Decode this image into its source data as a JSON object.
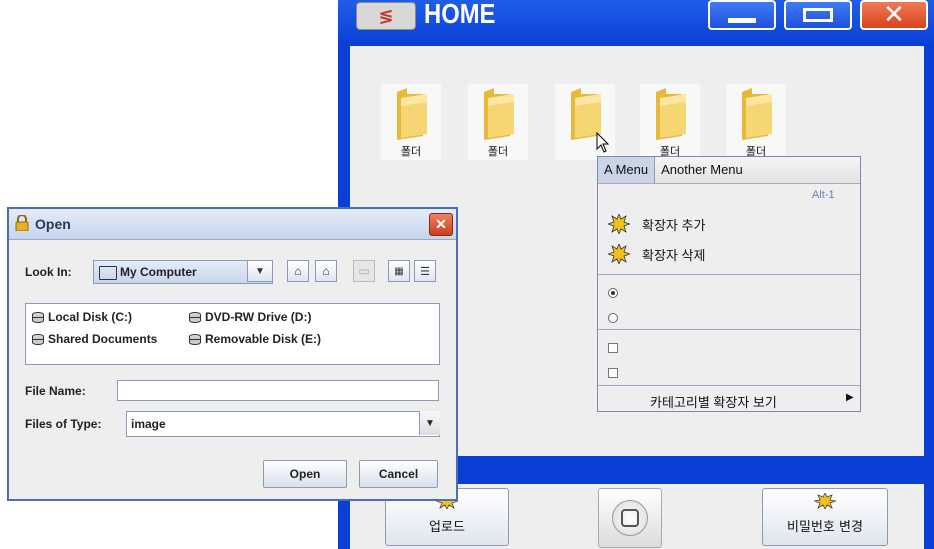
{
  "home": {
    "title": "HOME",
    "folders": [
      {
        "label": "폴더"
      },
      {
        "label": "폴더"
      },
      {
        "label": ""
      },
      {
        "label": "폴더"
      },
      {
        "label": "폴더"
      }
    ],
    "bottom_buttons": {
      "upload_label": "업로드",
      "change_password_label": "비밀번호 변경"
    }
  },
  "menu": {
    "tabs": [
      "A Menu",
      "Another Menu"
    ],
    "accelerator": "Alt-1",
    "items": {
      "add_extension": "확장자 추가",
      "delete_extension": "확장자 삭제",
      "view_by_category": "카테고리별 확장자 보기"
    },
    "radio_items": [
      {
        "selected": true
      },
      {
        "selected": false
      }
    ],
    "check_items": [
      {
        "checked": false
      },
      {
        "checked": false
      }
    ]
  },
  "dialog": {
    "title": "Open",
    "look_in_label": "Look In:",
    "look_in_value": "My Computer",
    "files": [
      "Local Disk (C:)",
      "DVD-RW Drive (D:)",
      "Shared Documents",
      "Removable Disk (E:)"
    ],
    "file_name_label": "File Name:",
    "file_name_value": "",
    "files_of_type_label": "Files of Type:",
    "files_of_type_value": "image",
    "open_button": "Open",
    "cancel_button": "Cancel"
  },
  "colors": {
    "window_blue": "#0a3fd6",
    "panel_gray": "#eeeeee",
    "close_red": "#d8431c",
    "folder_yellow": "#f2c94c"
  }
}
